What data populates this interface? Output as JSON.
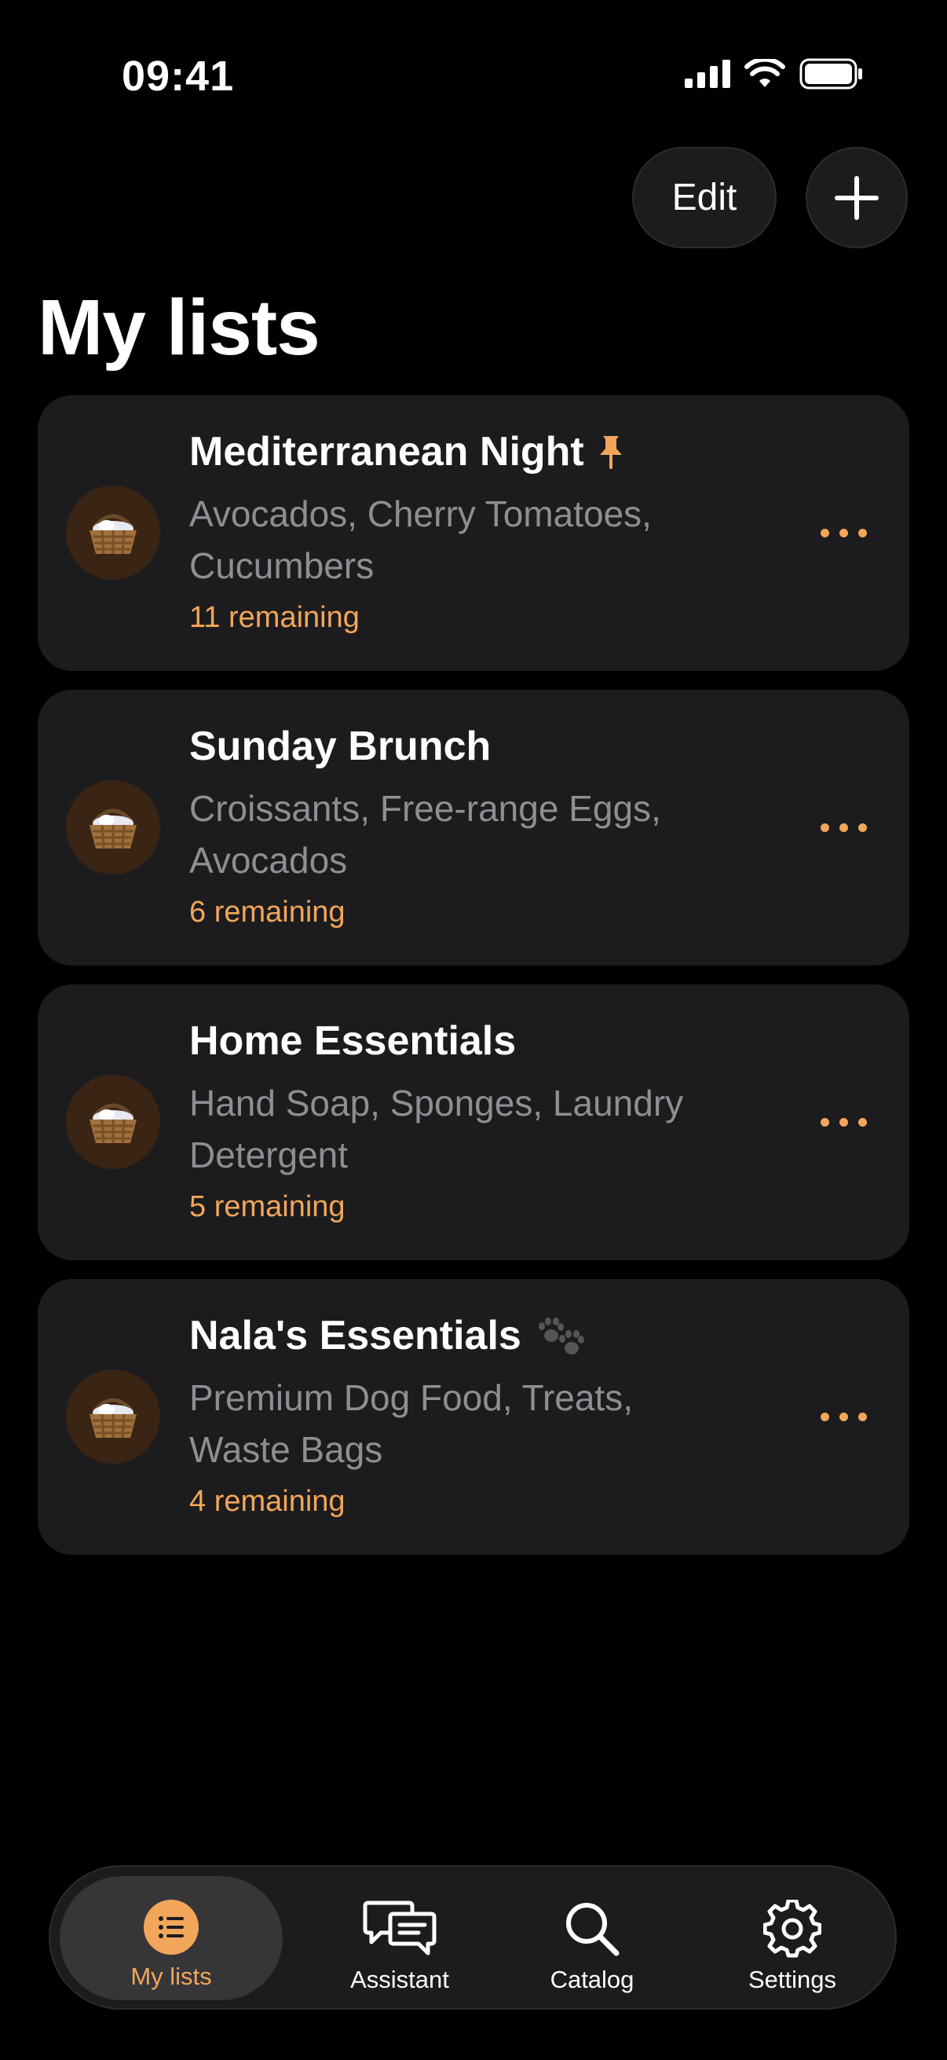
{
  "status_bar": {
    "time": "09:41"
  },
  "toolbar": {
    "edit_label": "Edit"
  },
  "header": {
    "title": "My lists"
  },
  "lists": [
    {
      "title": "Mediterranean Night",
      "badge": "pin-icon",
      "items": "Avocados, Cherry Tomatoes, Cucumbers",
      "remaining": "11 remaining"
    },
    {
      "title": "Sunday Brunch",
      "badge": "",
      "items": "Croissants, Free-range Eggs, Avocados",
      "remaining": "6 remaining"
    },
    {
      "title": "Home Essentials",
      "badge": "",
      "items": "Hand Soap, Sponges, Laundry Detergent",
      "remaining": "5 remaining"
    },
    {
      "title": "Nala's Essentials",
      "badge": "paw-icon",
      "items": "Premium Dog Food, Treats, Waste Bags",
      "remaining": "4 remaining"
    }
  ],
  "tabs": [
    {
      "label": "My lists",
      "icon": "list-icon",
      "active": true
    },
    {
      "label": "Assistant",
      "icon": "chat-icon",
      "active": false
    },
    {
      "label": "Catalog",
      "icon": "search-icon",
      "active": false
    },
    {
      "label": "Settings",
      "icon": "gear-icon",
      "active": false
    }
  ],
  "colors": {
    "accent": "#f2a65a",
    "card": "#1c1c1e",
    "background": "#000000",
    "secondary_text": "#8e8e93"
  }
}
